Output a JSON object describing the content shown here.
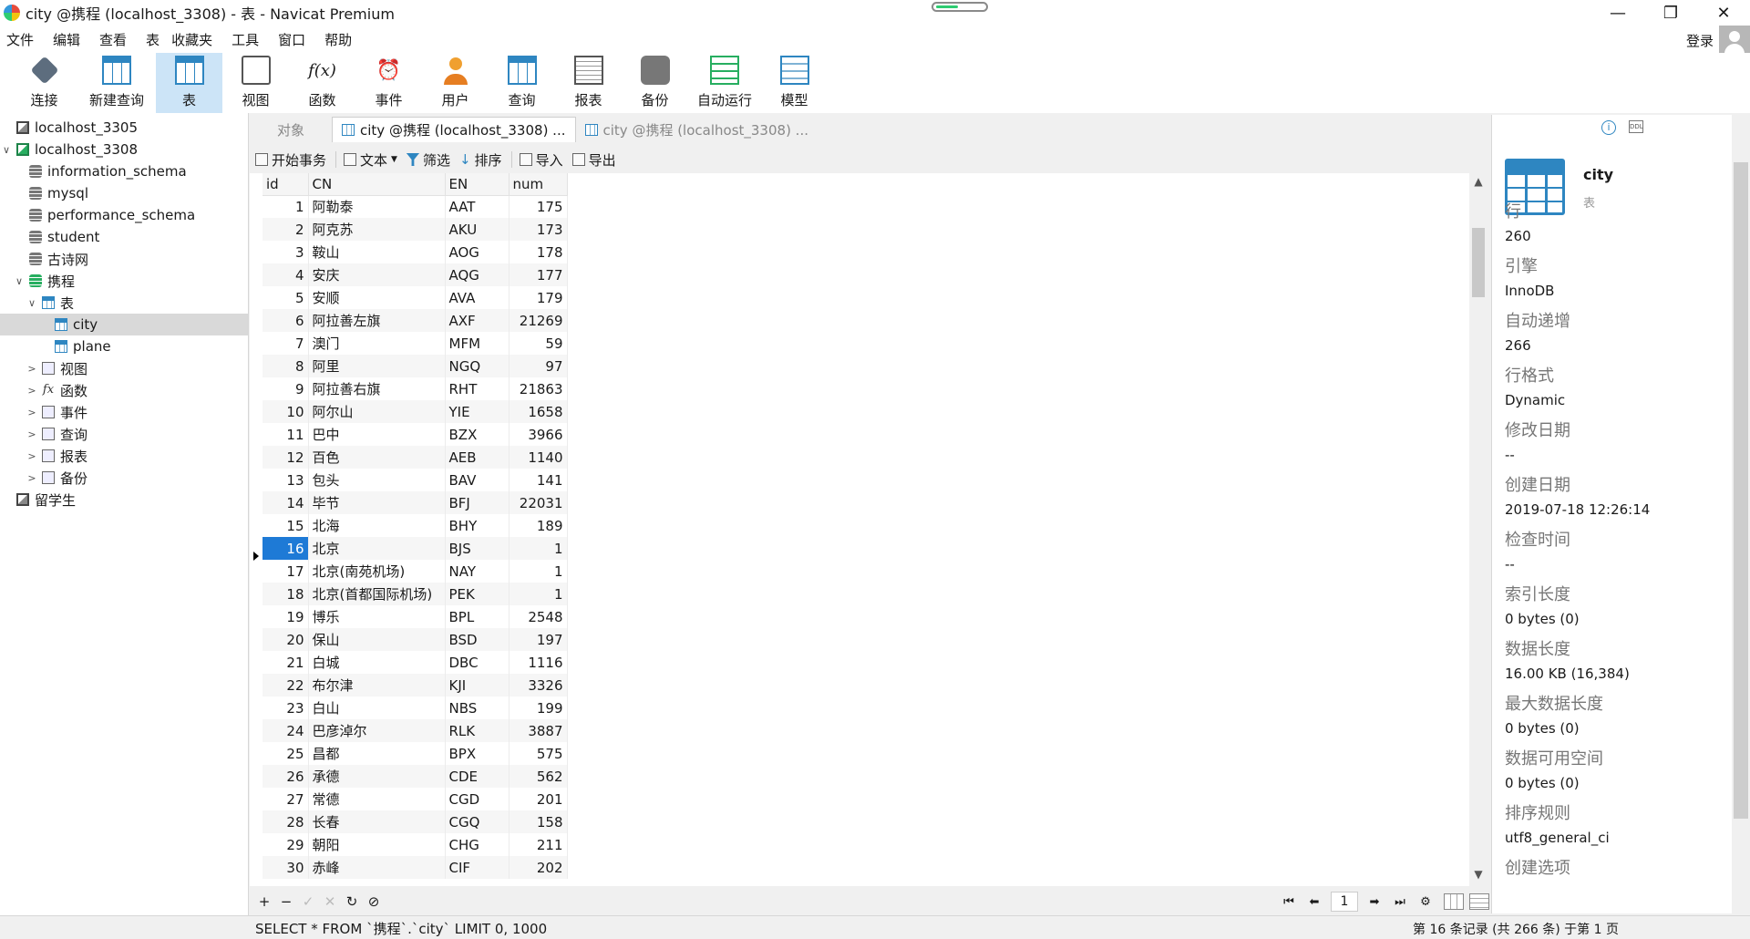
{
  "window": {
    "title": "city @携程 (localhost_3308) - 表 - Navicat Premium",
    "controls": [
      "—",
      "❐",
      "✕"
    ]
  },
  "menu": [
    "文件",
    "编辑",
    "查看",
    "表",
    "收藏夹",
    "工具",
    "窗口",
    "帮助"
  ],
  "login_label": "登录",
  "toolbar": [
    {
      "label": "连接",
      "icon": "connection-icon"
    },
    {
      "label": "新建查询",
      "icon": "new-query-icon"
    },
    {
      "label": "表",
      "icon": "table-icon"
    },
    {
      "label": "视图",
      "icon": "view-icon"
    },
    {
      "label": "函数",
      "icon": "function-icon",
      "glyph": "f(x)"
    },
    {
      "label": "事件",
      "icon": "event-icon",
      "glyph": "⏰"
    },
    {
      "label": "用户",
      "icon": "user-icon"
    },
    {
      "label": "查询",
      "icon": "query-icon"
    },
    {
      "label": "报表",
      "icon": "report-icon"
    },
    {
      "label": "备份",
      "icon": "backup-icon"
    },
    {
      "label": "自动运行",
      "icon": "automation-icon"
    },
    {
      "label": "模型",
      "icon": "model-icon"
    }
  ],
  "tree": [
    {
      "label": "localhost_3305",
      "icon": "server",
      "twisty": ""
    },
    {
      "label": "localhost_3308",
      "icon": "server-on",
      "twisty": "∨"
    },
    {
      "label": "information_schema",
      "icon": "db",
      "twisty": ""
    },
    {
      "label": "mysql",
      "icon": "db",
      "twisty": ""
    },
    {
      "label": "performance_schema",
      "icon": "db",
      "twisty": ""
    },
    {
      "label": "student",
      "icon": "db",
      "twisty": ""
    },
    {
      "label": "古诗网",
      "icon": "db",
      "twisty": ""
    },
    {
      "label": "携程",
      "icon": "db-on",
      "twisty": "∨"
    },
    {
      "label": "表",
      "icon": "tbl",
      "twisty": "∨"
    },
    {
      "label": "city",
      "icon": "tbl",
      "twisty": ""
    },
    {
      "label": "plane",
      "icon": "tbl",
      "twisty": ""
    },
    {
      "label": "视图",
      "icon": "gen",
      "twisty": ">"
    },
    {
      "label": "函数",
      "icon": "fx",
      "twisty": ">"
    },
    {
      "label": "事件",
      "icon": "gen",
      "twisty": ">"
    },
    {
      "label": "查询",
      "icon": "gen",
      "twisty": ">"
    },
    {
      "label": "报表",
      "icon": "gen",
      "twisty": ">"
    },
    {
      "label": "备份",
      "icon": "gen",
      "twisty": ">"
    },
    {
      "label": "留学生",
      "icon": "server",
      "twisty": ""
    }
  ],
  "tabs": [
    "对象",
    "city @携程 (localhost_3308) ...",
    "city @携程 (localhost_3308) ..."
  ],
  "subtoolbar": [
    "开始事务",
    "文本",
    "筛选",
    "排序",
    "导入",
    "导出"
  ],
  "grid": {
    "columns": [
      "id",
      "CN",
      "EN",
      "num"
    ],
    "current_row_id": "16",
    "rows": [
      [
        "1",
        "阿勒泰",
        "AAT",
        "175"
      ],
      [
        "2",
        "阿克苏",
        "AKU",
        "173"
      ],
      [
        "3",
        "鞍山",
        "AOG",
        "178"
      ],
      [
        "4",
        "安庆",
        "AQG",
        "177"
      ],
      [
        "5",
        "安顺",
        "AVA",
        "179"
      ],
      [
        "6",
        "阿拉善左旗",
        "AXF",
        "21269"
      ],
      [
        "7",
        "澳门",
        "MFM",
        "59"
      ],
      [
        "8",
        "阿里",
        "NGQ",
        "97"
      ],
      [
        "9",
        "阿拉善右旗",
        "RHT",
        "21863"
      ],
      [
        "10",
        "阿尔山",
        "YIE",
        "1658"
      ],
      [
        "11",
        "巴中",
        "BZX",
        "3966"
      ],
      [
        "12",
        "百色",
        "AEB",
        "1140"
      ],
      [
        "13",
        "包头",
        "BAV",
        "141"
      ],
      [
        "14",
        "毕节",
        "BFJ",
        "22031"
      ],
      [
        "15",
        "北海",
        "BHY",
        "189"
      ],
      [
        "16",
        "北京",
        "BJS",
        "1"
      ],
      [
        "17",
        "北京(南苑机场)",
        "NAY",
        "1"
      ],
      [
        "18",
        "北京(首都国际机场)",
        "PEK",
        "1"
      ],
      [
        "19",
        "博乐",
        "BPL",
        "2548"
      ],
      [
        "20",
        "保山",
        "BSD",
        "197"
      ],
      [
        "21",
        "白城",
        "DBC",
        "1116"
      ],
      [
        "22",
        "布尔津",
        "KJI",
        "3326"
      ],
      [
        "23",
        "白山",
        "NBS",
        "199"
      ],
      [
        "24",
        "巴彦淖尔",
        "RLK",
        "3887"
      ],
      [
        "25",
        "昌都",
        "BPX",
        "575"
      ],
      [
        "26",
        "承德",
        "CDE",
        "562"
      ],
      [
        "27",
        "常德",
        "CGD",
        "201"
      ],
      [
        "28",
        "长春",
        "CGQ",
        "158"
      ],
      [
        "29",
        "朝阳",
        "CHG",
        "211"
      ],
      [
        "30",
        "赤峰",
        "CIF",
        "202"
      ]
    ]
  },
  "bottom_buttons": [
    "+",
    "−",
    "✓",
    "✕",
    "↻",
    "⊘"
  ],
  "pager": {
    "first": "⏮",
    "prev": "⬅",
    "page": "1",
    "next": "➡",
    "last": "⏭",
    "settings": "⚙"
  },
  "status": {
    "sql": "SELECT * FROM `携程`.`city` LIMIT 0, 1000",
    "record": "第 16 条记录 (共 266 条) 于第 1 页"
  },
  "info": {
    "name": "city",
    "type": "表",
    "props": [
      {
        "k": "行",
        "v": "260"
      },
      {
        "k": "引擎",
        "v": "InnoDB"
      },
      {
        "k": "自动递增",
        "v": "266"
      },
      {
        "k": "行格式",
        "v": "Dynamic"
      },
      {
        "k": "修改日期",
        "v": "--"
      },
      {
        "k": "创建日期",
        "v": "2019-07-18 12:26:14"
      },
      {
        "k": "检查时间",
        "v": "--"
      },
      {
        "k": "索引长度",
        "v": "0 bytes (0)"
      },
      {
        "k": "数据长度",
        "v": "16.00 KB (16,384)"
      },
      {
        "k": "最大数据长度",
        "v": "0 bytes (0)"
      },
      {
        "k": "数据可用空间",
        "v": "0 bytes (0)"
      },
      {
        "k": "排序规则",
        "v": "utf8_general_ci"
      },
      {
        "k": "创建选项",
        "v": ""
      }
    ]
  }
}
